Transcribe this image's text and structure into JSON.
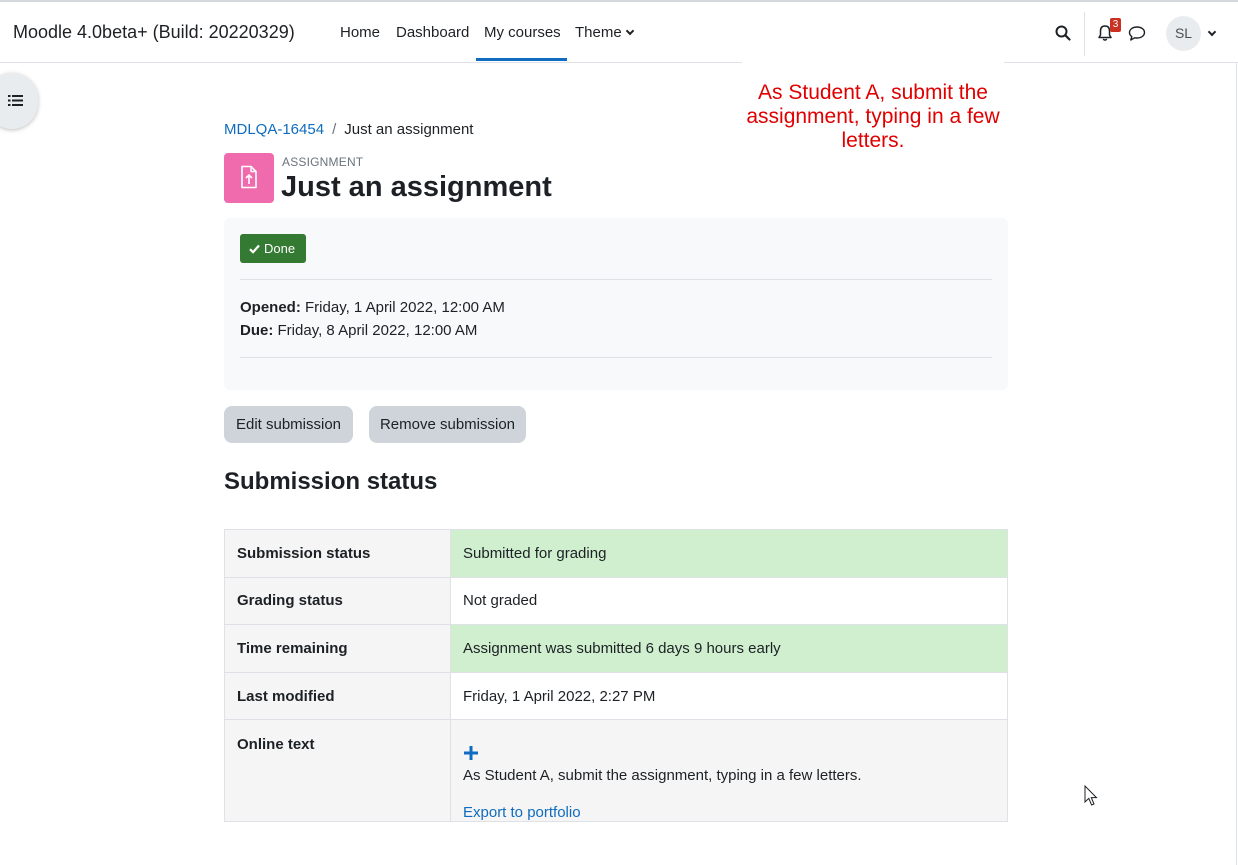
{
  "navbar": {
    "site_name": "Moodle 4.0beta+ (Build: 20220329)",
    "links": {
      "home": "Home",
      "dashboard": "Dashboard",
      "my_courses": "My courses",
      "theme": "Theme"
    },
    "active_link": "My courses",
    "notification_count": "3",
    "user_initials": "SL"
  },
  "annotation": {
    "text": "As Student A, submit the assignment, typing in a few letters."
  },
  "breadcrumb": {
    "course": "MDLQA-16454",
    "separator": "/",
    "current": "Just an assignment"
  },
  "header": {
    "pretitle": "ASSIGNMENT",
    "title": "Just an assignment"
  },
  "activity_info": {
    "completion_badge": "Done",
    "opened_label": "Opened:",
    "opened_value": "Friday, 1 April 2022, 12:00 AM",
    "due_label": "Due:",
    "due_value": "Friday, 8 April 2022, 12:00 AM"
  },
  "actions": {
    "edit_submission": "Edit submission",
    "remove_submission": "Remove submission"
  },
  "submission": {
    "section_title": "Submission status",
    "rows": [
      {
        "label": "Submission status",
        "value": "Submitted for grading"
      },
      {
        "label": "Grading status",
        "value": "Not graded"
      },
      {
        "label": "Time remaining",
        "value": "Assignment was submitted 6 days 9 hours early"
      },
      {
        "label": "Last modified",
        "value": "Friday, 1 April 2022, 2:27 PM"
      },
      {
        "label": "Online text",
        "value": "As Student A, submit the assignment, typing in a few letters.",
        "link": "Export to portfolio"
      }
    ]
  },
  "colors": {
    "primary": "#0f6cbf",
    "success_cell": "#cfefcf",
    "done_badge": "#357a32",
    "assignment_icon": "#f06bad",
    "annotation_text": "#e00000"
  }
}
